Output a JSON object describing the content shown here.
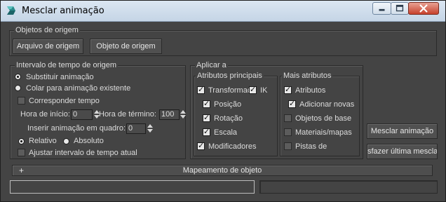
{
  "window": {
    "title": "Mesclar animação",
    "icon": "3dsmax-logo-icon",
    "controls": {
      "minimize": "minimize-icon",
      "maximize": "maximize-icon",
      "close": "close-icon"
    }
  },
  "source_objects": {
    "legend": "Objetos de origem",
    "file_button": "Arquivo de origem",
    "object_button": "Objeto de origem"
  },
  "source_time": {
    "legend": "Intervalo de tempo de origem",
    "replace_label": "Substituir animação",
    "paste_label": "Colar para animação existente",
    "match_time_label": "Corresponder tempo",
    "start_label": "Hora de início:",
    "start_value": "0",
    "end_label": "Hora de término:",
    "end_value": "100",
    "insert_label": "Inserir animação em quadro:",
    "insert_value": "0",
    "relative_label": "Relativo",
    "absolute_label": "Absoluto",
    "adjust_label": "Ajustar intervalo de tempo atual"
  },
  "apply_to": {
    "legend": "Aplicar a",
    "main": {
      "legend": "Atributos principais",
      "transform_label": "Transformaç",
      "ik_label": "IK",
      "position_label": "Posição",
      "rotation_label": "Rotação",
      "scale_label": "Escala",
      "modifiers_label": "Modificadores"
    },
    "more": {
      "legend": "Mais atributos",
      "attributes_label": "Atributos",
      "add_new_label": "Adicionar novas",
      "base_objects_label": "Objetos de base",
      "materials_label": "Materiais/mapas",
      "tracks_label": "Pistas de"
    }
  },
  "actions": {
    "merge_button": "Mesclar animação",
    "undo_button": "sfazer última mesclag"
  },
  "mapping": {
    "toggle": "+",
    "title": "Mapeamento de objeto"
  }
}
